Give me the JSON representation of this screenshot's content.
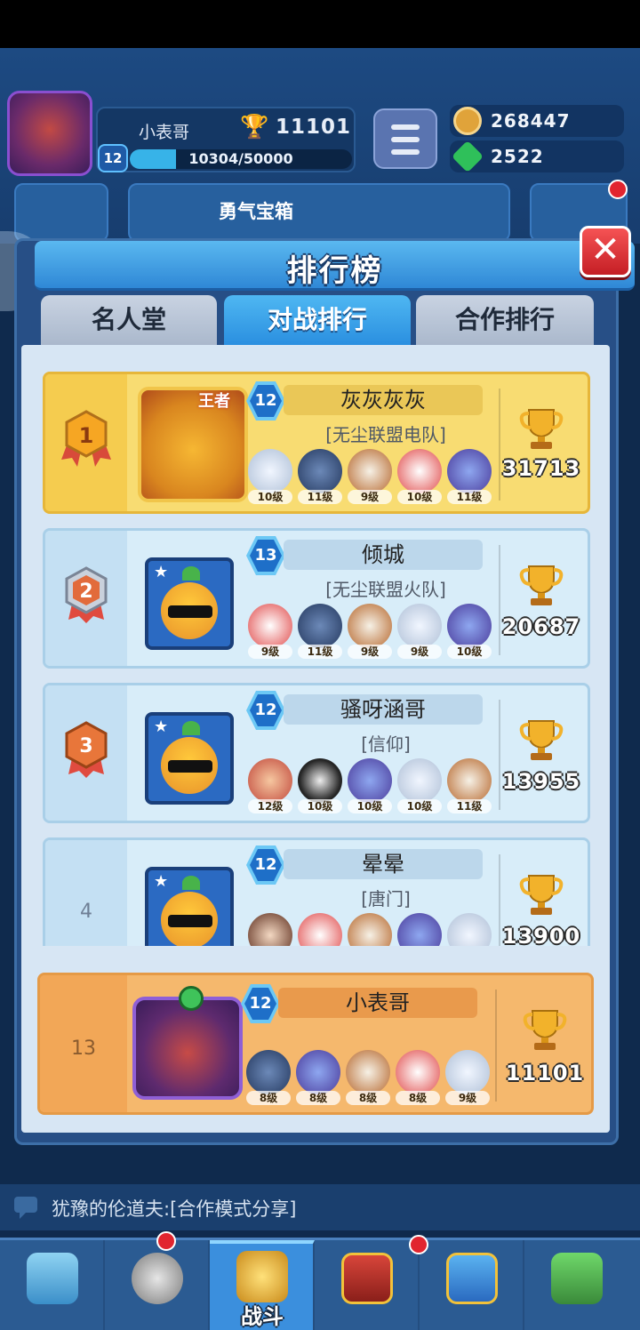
{
  "hud": {
    "player_name": "小表哥",
    "level": "12",
    "xp_text": "10304/50000",
    "xp_progress": 0.206,
    "trophies": "11101",
    "gold": "268447",
    "gems": "2522",
    "chest_label": "勇气宝箱"
  },
  "panel": {
    "title": "排行榜",
    "tabs": [
      "名人堂",
      "对战排行",
      "合作排行"
    ],
    "active_tab": 1
  },
  "entries": [
    {
      "rank": "1",
      "level": "12",
      "name": "灰灰灰灰",
      "guild": "[无尘联盟电队]",
      "trophies": "31713",
      "avatar_badge": "王者",
      "heroes": [
        "10级",
        "11级",
        "9级",
        "10级",
        "11级"
      ]
    },
    {
      "rank": "2",
      "level": "13",
      "name": "倾城",
      "guild": "[无尘联盟火队]",
      "trophies": "20687",
      "heroes": [
        "9级",
        "11级",
        "9级",
        "9级",
        "10级"
      ]
    },
    {
      "rank": "3",
      "level": "12",
      "name": "骚呀涵哥",
      "guild": "[信仰]",
      "trophies": "13955",
      "heroes": [
        "12级",
        "10级",
        "10级",
        "10级",
        "11级"
      ]
    },
    {
      "rank": "4",
      "level": "12",
      "name": "晕晕",
      "guild": "[唐门]",
      "trophies": "13900"
    }
  ],
  "my_entry": {
    "rank": "13",
    "level": "12",
    "name": "小表哥",
    "trophies": "11101",
    "heroes": [
      "8级",
      "8级",
      "8级",
      "8级",
      "9级"
    ]
  },
  "chat": {
    "text": "犹豫的伦道夫:[合作模式分享]"
  },
  "nav": {
    "items": [
      "",
      "",
      "战斗",
      "",
      "",
      ""
    ],
    "active": 2
  },
  "colors": {
    "gold_card": "#f8dc72",
    "blue_card": "#d8edf9",
    "mine_card": "#f5b86d",
    "active_tab": "#2a8fe0"
  }
}
